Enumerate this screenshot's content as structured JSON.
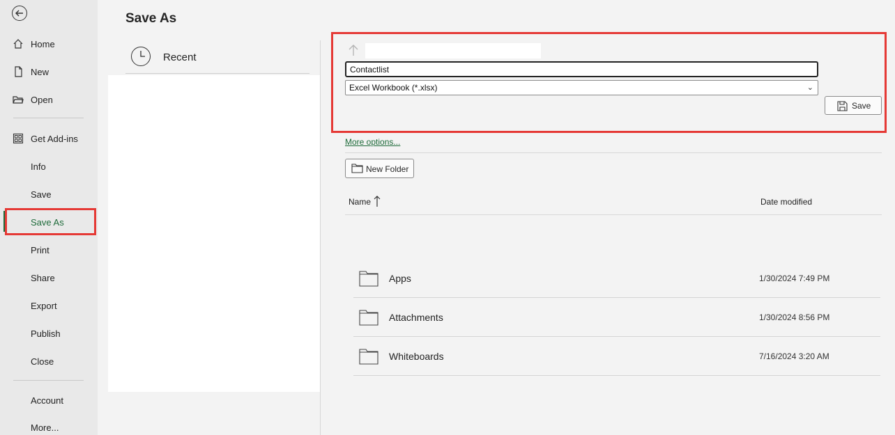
{
  "page": {
    "title": "Save As"
  },
  "nav": {
    "items": [
      {
        "label": "Home",
        "icon": "home-icon"
      },
      {
        "label": "New",
        "icon": "new-document-icon"
      },
      {
        "label": "Open",
        "icon": "open-folder-icon"
      },
      {
        "label": "Get Add-ins",
        "icon": "add-ins-grid-icon"
      },
      {
        "label": "Info"
      },
      {
        "label": "Save"
      },
      {
        "label": "Save As"
      },
      {
        "label": "Print"
      },
      {
        "label": "Share"
      },
      {
        "label": "Export"
      },
      {
        "label": "Publish"
      },
      {
        "label": "Close"
      },
      {
        "label": "Account"
      },
      {
        "label": "More..."
      }
    ],
    "active": "Save As"
  },
  "locations": {
    "recent_label": "Recent"
  },
  "save_form": {
    "file_name": "Contactlist",
    "file_type": "Excel Workbook (*.xlsx)",
    "save_label": "Save",
    "more_options": "More options...",
    "new_folder": "New Folder"
  },
  "file_list": {
    "col_name": "Name",
    "col_date": "Date modified",
    "rows": [
      {
        "name": "Apps",
        "date": "1/30/2024 7:49 PM"
      },
      {
        "name": "Attachments",
        "date": "1/30/2024 8:56 PM"
      },
      {
        "name": "Whiteboards",
        "date": "7/16/2024 3:20 AM"
      }
    ]
  },
  "colors": {
    "accent": "#1e6b3a",
    "highlight": "#e53935"
  }
}
